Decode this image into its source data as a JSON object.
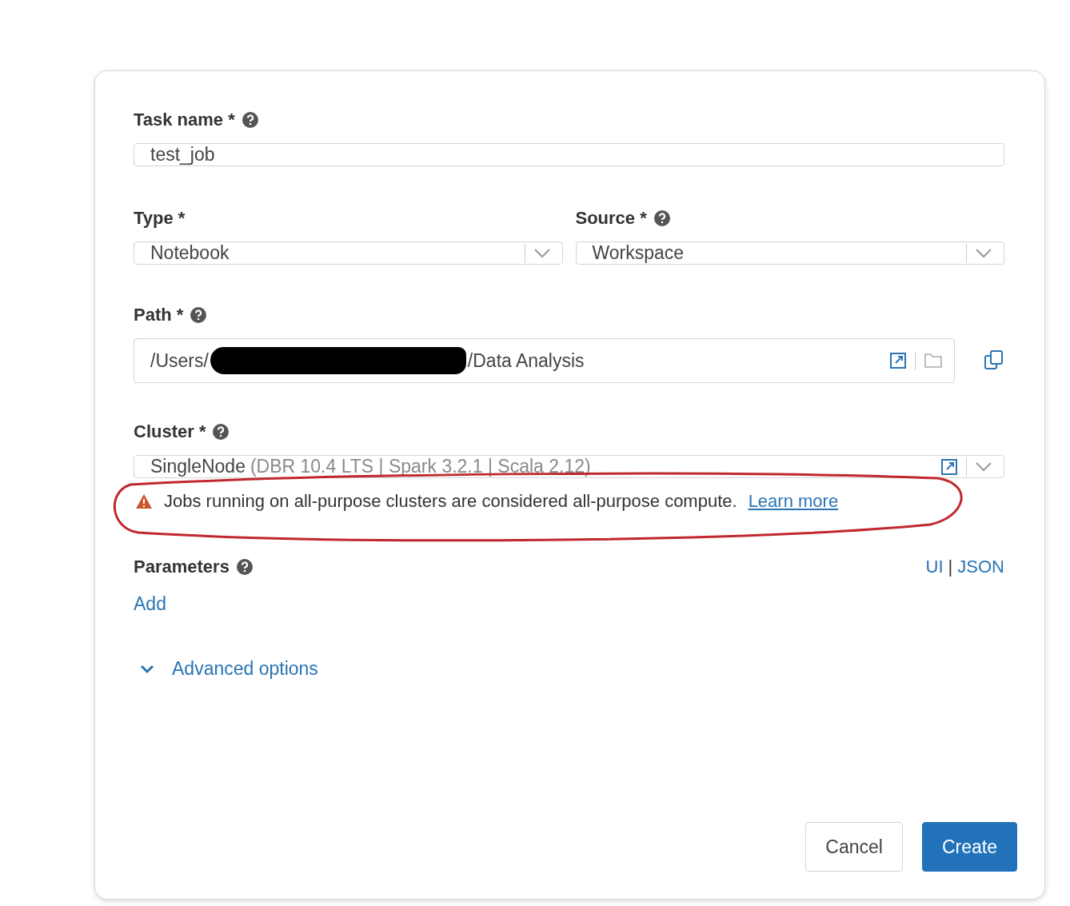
{
  "task_name": {
    "label": "Task name",
    "required_mark": "*",
    "has_help": true,
    "value": "test_job"
  },
  "type": {
    "label": "Type",
    "required_mark": "*",
    "has_help": false,
    "value": "Notebook"
  },
  "source": {
    "label": "Source",
    "required_mark": "*",
    "has_help": true,
    "value": "Workspace"
  },
  "path": {
    "label": "Path",
    "required_mark": "*",
    "has_help": true,
    "prefix": "/Users/",
    "redacted": true,
    "suffix": "/Data Analysis"
  },
  "cluster": {
    "label": "Cluster",
    "required_mark": "*",
    "has_help": true,
    "name": "SingleNode",
    "detail": "(DBR 10.4 LTS | Spark 3.2.1 | Scala 2.12)"
  },
  "warning": {
    "text": "Jobs running on all-purpose clusters are considered all-purpose compute.",
    "link": "Learn more",
    "highlighted": true
  },
  "parameters": {
    "label": "Parameters",
    "has_help": true,
    "add": "Add",
    "modes": [
      {
        "label": "UI"
      },
      {
        "label": "JSON"
      }
    ],
    "separator": "|"
  },
  "advanced_options": {
    "label": "Advanced options",
    "expanded": false
  },
  "buttons": [
    {
      "label": "Cancel",
      "kind": "secondary"
    },
    {
      "label": "Create",
      "kind": "primary"
    }
  ]
}
